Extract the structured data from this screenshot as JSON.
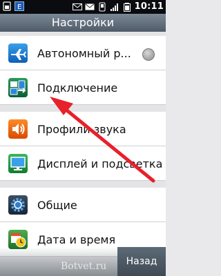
{
  "status_bar": {
    "time": "10:11",
    "icons": [
      "sim-icon",
      "e-network-icon",
      "envelope-icon",
      "sms-icon",
      "phone-icon",
      "signal-icon",
      "battery-icon"
    ],
    "network_letter": "E"
  },
  "header": {
    "title": "Настройки"
  },
  "settings": {
    "airplane": "Автономный р...",
    "connection": "Подключение",
    "sound_profiles": "Профили звука",
    "display": "Дисплей и подсветка",
    "general": "Общие",
    "datetime": "Дата и время"
  },
  "footer": {
    "back_label": "Назад",
    "watermark": "Botvet.ru"
  },
  "colors": {
    "arrow": "#e8202a",
    "title_bar": "#5e6b79",
    "status_bar": "#0b0c0f"
  }
}
